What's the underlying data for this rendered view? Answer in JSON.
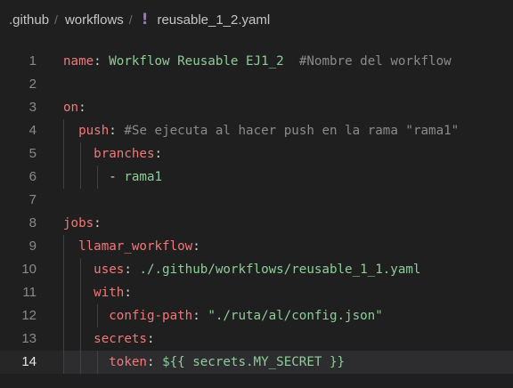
{
  "breadcrumb": {
    "folder1": ".github",
    "folder2": "workflows",
    "file": "reusable_1_2.yaml",
    "separator": "/",
    "file_icon": "!",
    "file_icon_name": "yaml-exclamation-icon",
    "file_icon_color": "#a074c4"
  },
  "editor": {
    "lines": [
      {
        "n": "1",
        "tokens": [
          {
            "t": "name",
            "c": "k"
          },
          {
            "t": ": ",
            "c": "p"
          },
          {
            "t": "Workflow Reusable EJ1_2",
            "c": "s"
          },
          {
            "t": "  ",
            "c": "p"
          },
          {
            "t": "#Nombre del workflow",
            "c": "c"
          }
        ]
      },
      {
        "n": "2",
        "tokens": []
      },
      {
        "n": "3",
        "tokens": [
          {
            "t": "on",
            "c": "k"
          },
          {
            "t": ":",
            "c": "p"
          }
        ]
      },
      {
        "n": "4",
        "tokens": [
          {
            "t": "  ",
            "c": "p"
          },
          {
            "t": "push",
            "c": "k"
          },
          {
            "t": ": ",
            "c": "p"
          },
          {
            "t": "#Se ejecuta al hacer push en la rama \"rama1\"",
            "c": "c"
          }
        ]
      },
      {
        "n": "5",
        "tokens": [
          {
            "t": "    ",
            "c": "p"
          },
          {
            "t": "branches",
            "c": "k"
          },
          {
            "t": ":",
            "c": "p"
          }
        ]
      },
      {
        "n": "6",
        "tokens": [
          {
            "t": "      - ",
            "c": "p"
          },
          {
            "t": "rama1",
            "c": "s"
          }
        ]
      },
      {
        "n": "7",
        "tokens": []
      },
      {
        "n": "8",
        "tokens": [
          {
            "t": "jobs",
            "c": "k"
          },
          {
            "t": ":",
            "c": "p"
          }
        ]
      },
      {
        "n": "9",
        "tokens": [
          {
            "t": "  ",
            "c": "p"
          },
          {
            "t": "llamar_workflow",
            "c": "k"
          },
          {
            "t": ":",
            "c": "p"
          }
        ]
      },
      {
        "n": "10",
        "tokens": [
          {
            "t": "    ",
            "c": "p"
          },
          {
            "t": "uses",
            "c": "k"
          },
          {
            "t": ": ",
            "c": "p"
          },
          {
            "t": "./.github/workflows/reusable_1_1.yaml",
            "c": "s"
          }
        ]
      },
      {
        "n": "11",
        "tokens": [
          {
            "t": "    ",
            "c": "p"
          },
          {
            "t": "with",
            "c": "k"
          },
          {
            "t": ":",
            "c": "p"
          }
        ]
      },
      {
        "n": "12",
        "tokens": [
          {
            "t": "      ",
            "c": "p"
          },
          {
            "t": "config-path",
            "c": "k"
          },
          {
            "t": ": ",
            "c": "p"
          },
          {
            "t": "\"./ruta/al/config.json\"",
            "c": "s"
          }
        ]
      },
      {
        "n": "13",
        "tokens": [
          {
            "t": "    ",
            "c": "p"
          },
          {
            "t": "secrets",
            "c": "k"
          },
          {
            "t": ":",
            "c": "p"
          }
        ]
      },
      {
        "n": "14",
        "tokens": [
          {
            "t": "      ",
            "c": "p"
          },
          {
            "t": "token",
            "c": "k"
          },
          {
            "t": ": ",
            "c": "p"
          },
          {
            "t": "${{ secrets.MY_SECRET }}",
            "c": "s"
          }
        ]
      }
    ],
    "current_line": "14",
    "colors": {
      "key": "#f47777",
      "string": "#8ecd9a",
      "comment": "#8b8b8b",
      "background": "#1f1f1f"
    }
  }
}
